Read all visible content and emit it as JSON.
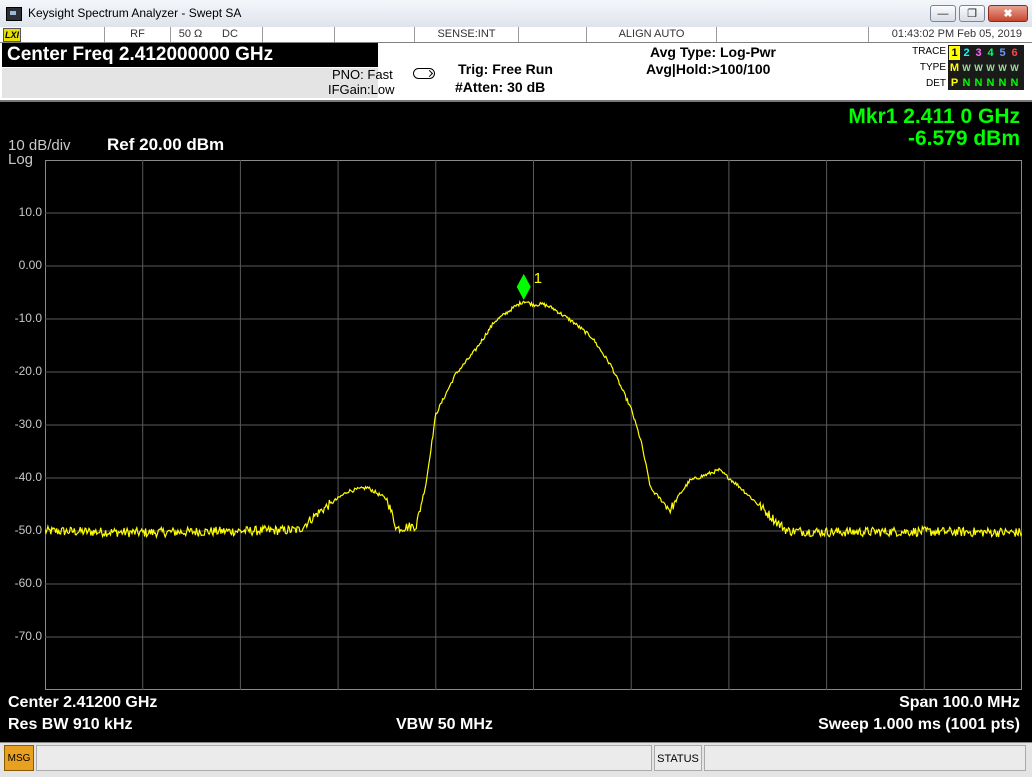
{
  "window": {
    "title": "Keysight Spectrum Analyzer - Swept SA",
    "minimize_glyph": "—",
    "restore_glyph": "❐",
    "close_glyph": "✖"
  },
  "status_strip": {
    "lxi": "LXI",
    "rf": "RF",
    "impedance": "50 Ω",
    "coupling": "DC",
    "sense": "SENSE:INT",
    "align": "ALIGN AUTO",
    "timestamp": "01:43:02 PM Feb 05, 2019"
  },
  "settings": {
    "center_freq": "Center Freq 2.412000000 GHz",
    "pno": "PNO: Fast",
    "ifgain": "IFGain:Low",
    "trig": "Trig: Free Run",
    "atten": "#Atten: 30 dB",
    "avg_type": "Avg Type: Log-Pwr",
    "avg_hold": "Avg|Hold:>100/100",
    "trace_label": "TRACE",
    "type_label": "TYPE",
    "det_label": "DET",
    "trace_numbers": [
      "1",
      "2",
      "3",
      "4",
      "5",
      "6"
    ],
    "trace_colors": [
      "#ffff00",
      "#00ffff",
      "#ff66ff",
      "#00ff66",
      "#6699ff",
      "#ff4444"
    ],
    "type_values": [
      "M",
      "W",
      "W",
      "W",
      "W",
      "W"
    ],
    "det_values": [
      "P",
      "N",
      "N",
      "N",
      "N",
      "N"
    ]
  },
  "display": {
    "scale": "10 dB/div",
    "scale_type": "Log",
    "ref": "Ref 20.00 dBm",
    "marker_freq": "Mkr1 2.411 0 GHz",
    "marker_amp": "-6.579 dBm",
    "marker_label": "1",
    "y_tick_labels": [
      "10.0",
      "0.00",
      "-10.0",
      "-20.0",
      "-30.0",
      "-40.0",
      "-50.0",
      "-60.0",
      "-70.0"
    ],
    "trace_color": "#ffff00",
    "marker_color": "#00ff00"
  },
  "footer": {
    "center": "Center 2.41200 GHz",
    "span": "Span 100.0 MHz",
    "rbw": "Res BW 910 kHz",
    "vbw": "VBW 50 MHz",
    "sweep": "Sweep  1.000 ms (1001 pts)"
  },
  "message_bar": {
    "msg": "MSG",
    "status": "STATUS"
  },
  "chart_data": {
    "type": "line",
    "ylim": [
      -80,
      20
    ],
    "xlim": [
      2.362,
      2.462
    ],
    "grid": true,
    "x": [
      2.362,
      2.372,
      2.382,
      2.388,
      2.39,
      2.393,
      2.395,
      2.397,
      2.398,
      2.4,
      2.401,
      2.402,
      2.404,
      2.406,
      2.408,
      2.41,
      2.411,
      2.412,
      2.413,
      2.414,
      2.416,
      2.418,
      2.42,
      2.422,
      2.423,
      2.424,
      2.426,
      2.427,
      2.428,
      2.431,
      2.433,
      2.435,
      2.437,
      2.438,
      2.442,
      2.452,
      2.462
    ],
    "series": [
      {
        "values": [
          -50.0,
          -50.3,
          -50.0,
          -49.8,
          -46.5,
          -42.5,
          -41.8,
          -44.0,
          -49.5,
          -49.0,
          -41.0,
          -28.0,
          -20.5,
          -16.0,
          -10.5,
          -7.8,
          -6.6,
          -7.3,
          -7.2,
          -8.0,
          -10.5,
          -13.5,
          -19.0,
          -27.0,
          -33.0,
          -42.0,
          -46.0,
          -43.0,
          -40.5,
          -38.5,
          -41.5,
          -45.0,
          -48.5,
          -50.0,
          -50.2,
          -50.1,
          -50.3
        ]
      }
    ],
    "marker": {
      "x": 2.411,
      "y": -6.579,
      "label": "1"
    }
  }
}
